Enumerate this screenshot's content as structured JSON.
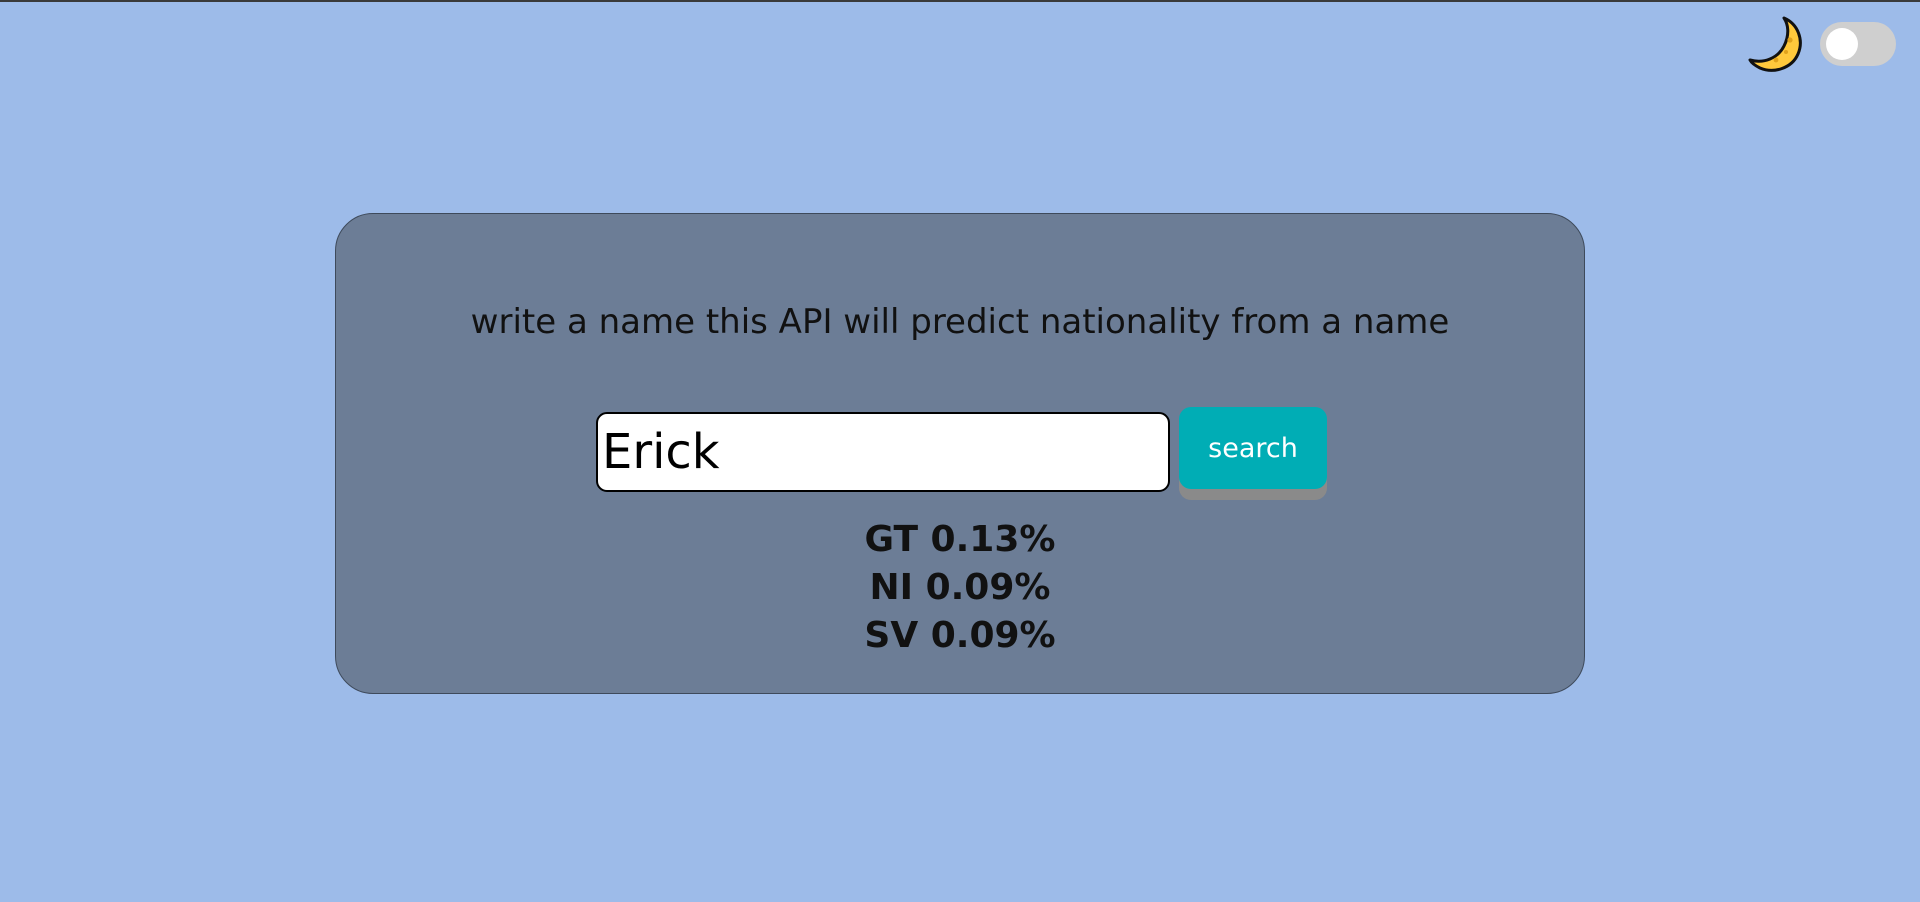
{
  "theme": {
    "moon_icon": "crescent-moon-icon",
    "toggle_state": "off",
    "colors": {
      "background": "#9dbbe9",
      "card": "#6c7d96",
      "button": "#00adb5"
    }
  },
  "main": {
    "headline": "write a name this API will predict nationality from a name",
    "input_value": "Erick",
    "search_label": "search",
    "results": [
      {
        "text": "GT 0.13%"
      },
      {
        "text": "NI 0.09%"
      },
      {
        "text": "SV 0.09%"
      }
    ]
  }
}
